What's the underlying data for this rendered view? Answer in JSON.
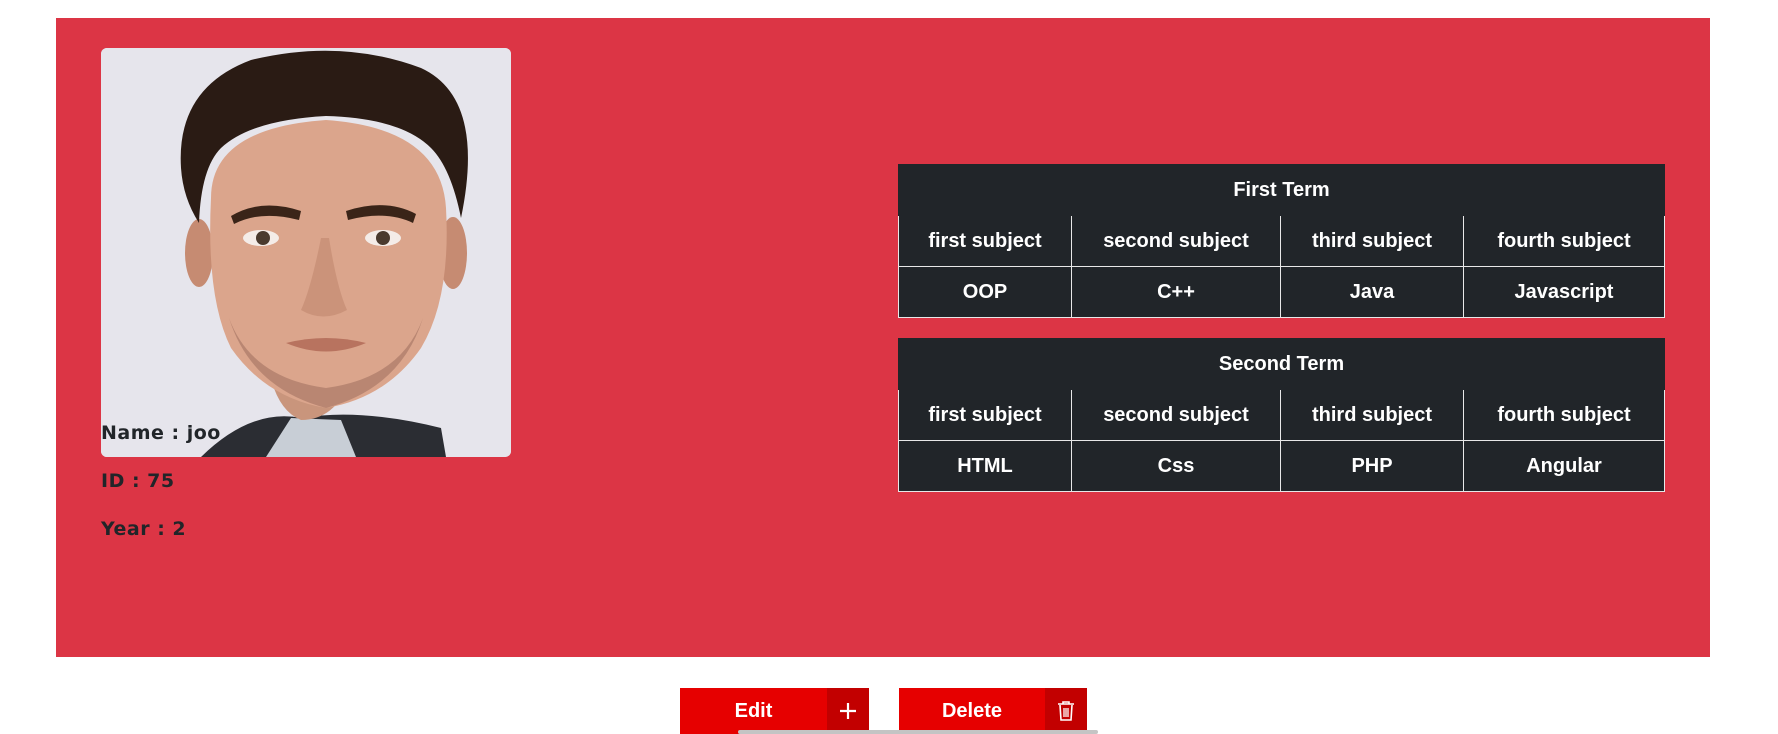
{
  "profile": {
    "photo_alt": "student photo",
    "name_label": "Name : joo",
    "id_label": "ID : 75",
    "year_label": "Year : 2"
  },
  "terms": [
    {
      "title": "First Term",
      "headers": [
        "first subject",
        "second subject",
        "third subject",
        "fourth subject"
      ],
      "subjects": [
        "OOP",
        "C++",
        "Java",
        "Javascript"
      ]
    },
    {
      "title": "Second Term",
      "headers": [
        "first subject",
        "second subject",
        "third subject",
        "fourth subject"
      ],
      "subjects": [
        "HTML",
        "Css",
        "PHP",
        "Angular"
      ]
    }
  ],
  "actions": {
    "edit_label": "Edit",
    "edit_icon": "plus-icon",
    "delete_label": "Delete",
    "delete_icon": "trash-icon"
  },
  "colors": {
    "card_background": "#dc3545",
    "table_background": "#212529",
    "button_background": "#e60000",
    "button_icon_background": "#c20000"
  }
}
